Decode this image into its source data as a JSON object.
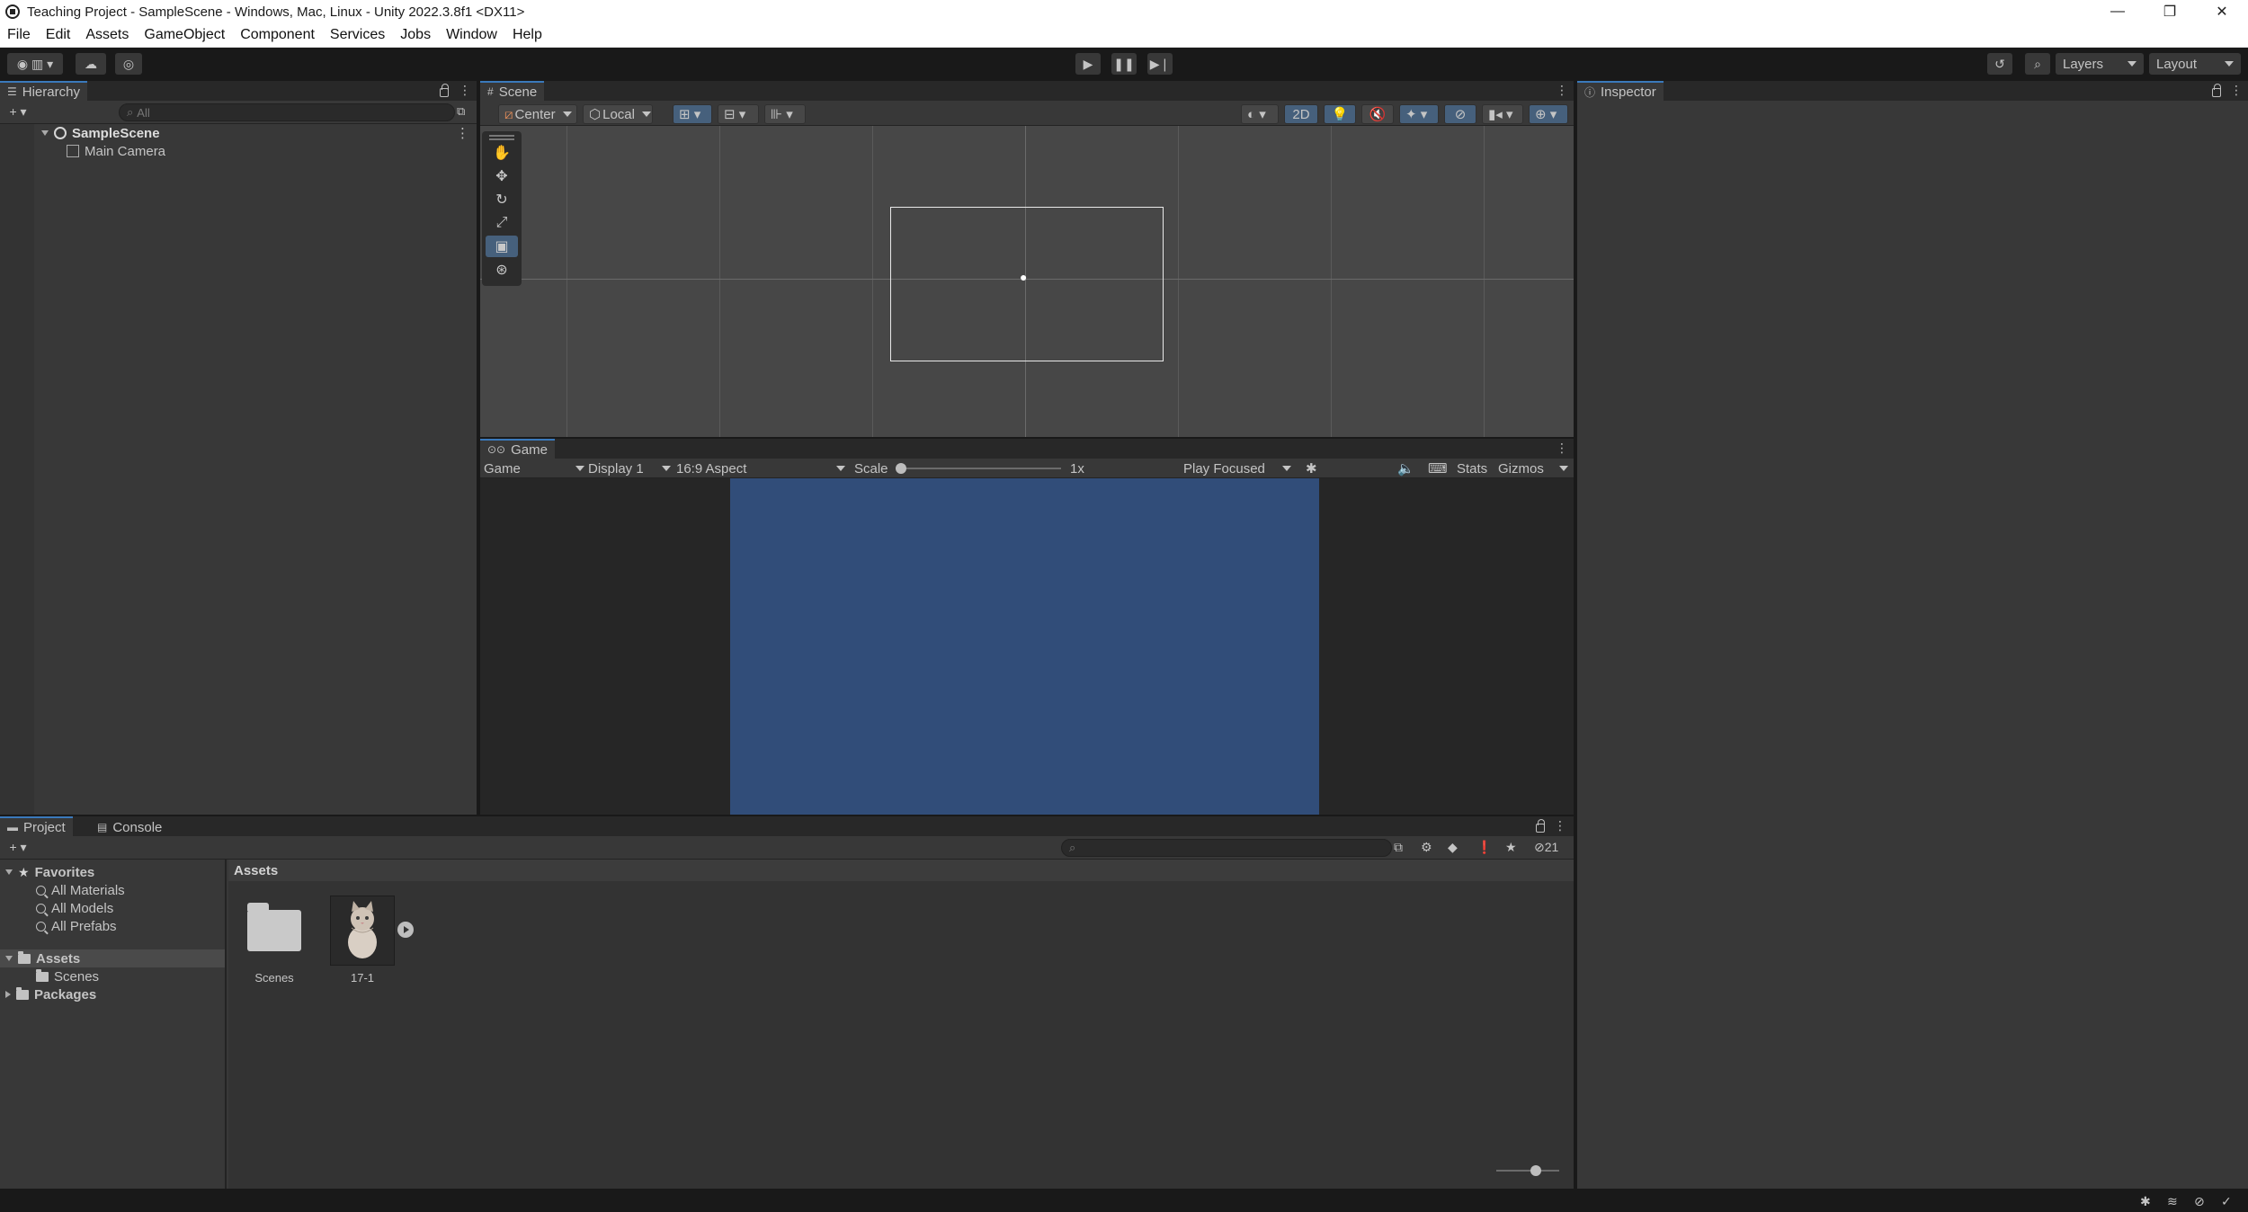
{
  "window": {
    "title": "Teaching Project - SampleScene - Windows, Mac, Linux - Unity 2022.3.8f1 <DX11>",
    "controls": [
      "—",
      "❐",
      "✕"
    ]
  },
  "menu": [
    "File",
    "Edit",
    "Assets",
    "GameObject",
    "Component",
    "Services",
    "Jobs",
    "Window",
    "Help"
  ],
  "toolbar": {
    "layers_label": "Layers",
    "layout_label": "Layout"
  },
  "hierarchy": {
    "tab_label": "Hierarchy",
    "search_placeholder": "All",
    "scene_name": "SampleScene",
    "objects": [
      "Main Camera"
    ]
  },
  "scene": {
    "tab_label": "Scene",
    "pivot_label": "Center",
    "space_label": "Local",
    "mode_2d_label": "2D"
  },
  "game": {
    "tab_label": "Game",
    "view_select": "Game",
    "display_select": "Display 1",
    "aspect_select": "16:9 Aspect",
    "scale_label": "Scale",
    "scale_value": "1x",
    "scale_fraction": 0,
    "play_mode": "Play Focused",
    "stats_label": "Stats",
    "gizmos_label": "Gizmos",
    "background_color": "#314d79"
  },
  "inspector": {
    "tab_label": "Inspector"
  },
  "project": {
    "tab_project": "Project",
    "tab_console": "Console",
    "hidden_count": "21",
    "favorites_label": "Favorites",
    "favorites": [
      "All Materials",
      "All Models",
      "All Prefabs"
    ],
    "assets_label": "Assets",
    "assets_children": [
      "Scenes"
    ],
    "packages_label": "Packages",
    "breadcrumb": "Assets",
    "items": [
      {
        "name": "Scenes",
        "kind": "folder"
      },
      {
        "name": "17-1",
        "kind": "video"
      }
    ]
  },
  "colors": {
    "accent_blue": "#46607c",
    "game_background": "#314d79"
  }
}
